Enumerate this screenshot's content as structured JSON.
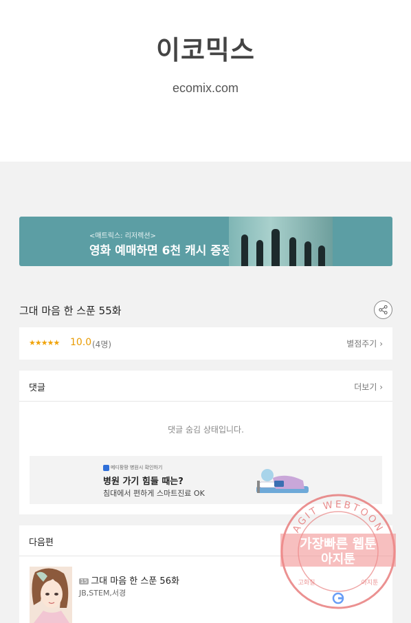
{
  "logo": {
    "korean": "이코믹스",
    "url": "ecomix.com"
  },
  "top_banner": {
    "subtitle": "<매트릭스: 리저렉션>",
    "headline": "영화 예매하면 6천 캐시 증정!",
    "colors": {
      "background": "#5c9ea4"
    }
  },
  "episode": {
    "title": "그대 마음 한 스푼 55화",
    "share_icon": "share-icon"
  },
  "rating": {
    "stars": "★★★★★",
    "star_count": 5,
    "score": "10.0",
    "voters": "(4명)",
    "rate_label": "별점주기",
    "chevron": "›",
    "colors": {
      "star": "#f0a30a"
    }
  },
  "comments": {
    "header": "댓글",
    "more_label": "더보기",
    "chevron": "›",
    "hidden_notice": "댓글 숨김 상태입니다.",
    "ad": {
      "badge": "메디팡팡 병원시 확인하기",
      "title": "병원 가기 힘들 때는?",
      "subtitle": "침대에서 편하게 스마트진료 OK"
    }
  },
  "next_episode": {
    "header": "다음편",
    "age_badge": "15",
    "title": "그대 마음 한 스푼 56화",
    "authors": "JB,STEM,서경"
  },
  "watermark": {
    "top_arc": "AGIT WEBTOON",
    "line1": "가장빠른 웹툰",
    "line2": "아지툰",
    "bottom_left": "고화질",
    "bottom_right": "아지툰"
  }
}
